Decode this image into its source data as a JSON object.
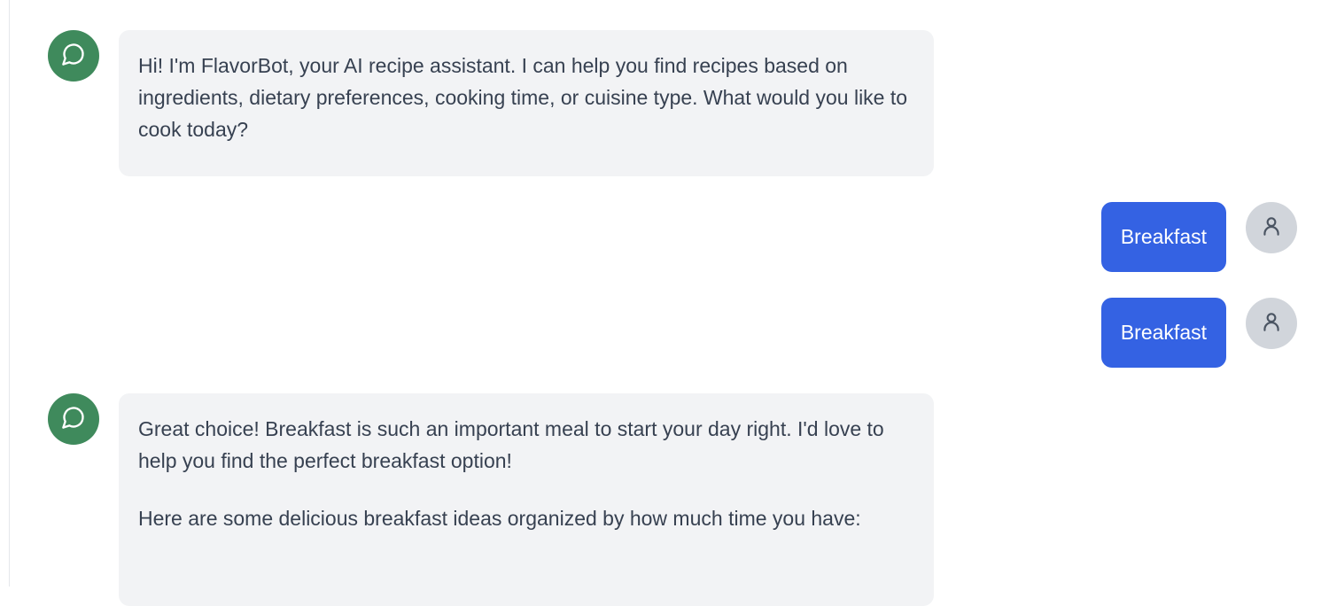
{
  "messages": [
    {
      "role": "bot",
      "avatar_icon": "chat-bubble-icon",
      "paragraphs": [
        "Hi! I'm FlavorBot, your AI recipe assistant. I can help you find recipes based on ingredients, dietary preferences, cooking time, or cuisine type. What would you like to cook today?"
      ]
    },
    {
      "role": "user",
      "avatar_icon": "user-icon",
      "text": "Breakfast"
    },
    {
      "role": "user",
      "avatar_icon": "user-icon",
      "text": "Breakfast"
    },
    {
      "role": "bot",
      "avatar_icon": "chat-bubble-icon",
      "paragraphs": [
        "Great choice! Breakfast is such an important meal to start your day right. I'd love to help you find the perfect breakfast option!",
        "Here are some delicious breakfast ideas organized by how much time you have:"
      ]
    }
  ],
  "colors": {
    "bot_avatar": "#3f8a5c",
    "user_bubble": "#3462e3",
    "bot_bubble": "#f2f3f5",
    "user_avatar": "#d1d5db"
  }
}
